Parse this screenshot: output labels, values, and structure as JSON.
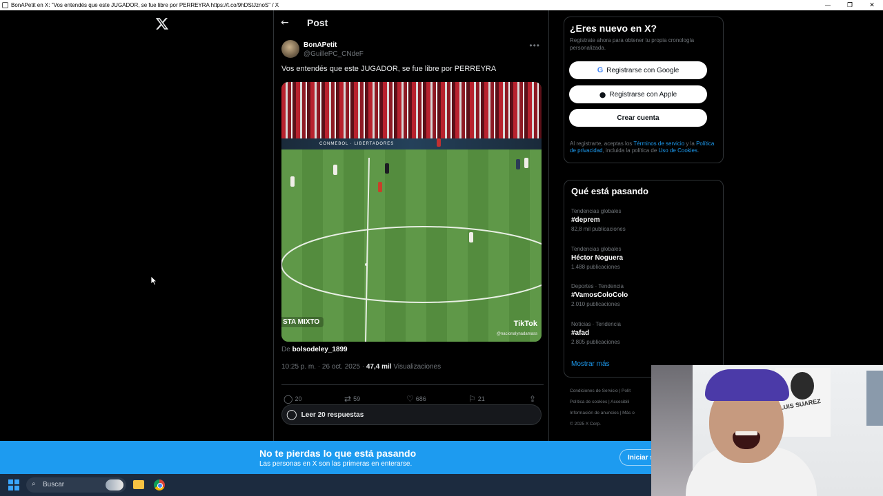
{
  "window": {
    "title": "BonAPetit en X: \"Vos entendés que este JUGADOR, se fue libre por PERREYRA https://t.co/9hDStJznoS\" / X",
    "controls": [
      "—",
      "❐",
      "✕"
    ]
  },
  "post": {
    "header_title": "Post",
    "author_name": "BonAPetit",
    "author_handle": "@GuillePC_CNdeF",
    "text": "Vos entendés que este JUGADOR, se fue libre por PERREYRA",
    "video": {
      "overlay_left": "STA MIXTO",
      "overlay_brand": "TikTok",
      "overlay_handle": "@nacionalynadamass",
      "adboard": "CONMEBOL · LIBERTADORES"
    },
    "from_prefix": "De",
    "from_user": "bolsodeley_1899",
    "time_date": "10:25 p. m. · 26 oct. 2025 · ",
    "views_count": "47,4 mil",
    "views_label": " Visualizaciones",
    "stats": {
      "replies": "20",
      "reposts": "59",
      "likes": "686",
      "bookmarks": "21"
    },
    "read_replies": "Leer 20 respuestas"
  },
  "signup": {
    "title": "¿Eres nuevo en X?",
    "subtitle": "Regístrate ahora para obtener tu propia cronología personalizada.",
    "google_label": "Registrarse con Google",
    "apple_label": "Registrarse con Apple",
    "create_label": "Crear cuenta",
    "legal_prefix": "Al registrarte, aceptas los ",
    "legal_terms": "Términos de servicio",
    "legal_mid1": " y la ",
    "legal_privacy": "Política de privacidad",
    "legal_mid2": ", incluida la política de ",
    "legal_cookies": "Uso de Cookies",
    "legal_end": "."
  },
  "trends": {
    "title": "Qué está pasando",
    "items": [
      {
        "context": "Tendencias globales",
        "name": "#deprem",
        "count": "82,8 mil publicaciones"
      },
      {
        "context": "Tendencias globales",
        "name": "Héctor Noguera",
        "count": "1.488 publicaciones"
      },
      {
        "context": "Deportes · Tendencia",
        "name": "#VamosColoColo",
        "count": "2.010 publicaciones"
      },
      {
        "context": "Noticias · Tendencia",
        "name": "#afad",
        "count": "2.805 publicaciones"
      }
    ],
    "show_more": "Mostrar más"
  },
  "footer": {
    "line1": "Condiciones de Servicio  |  Polít",
    "line2": "Política de cookies  |  Accesibili",
    "line3": "Información de anuncios  |  Más o",
    "line4": "© 2025 X Corp."
  },
  "banner": {
    "title": "No te pierdas lo que está pasando",
    "subtitle": "Las personas en X son las primeras en enterarse.",
    "button": "Iniciar s"
  },
  "taskbar": {
    "search_label": "Buscar"
  },
  "webcam": {
    "poster_text": "LUIS SUAREZ"
  },
  "colors": {
    "accent": "#1d9bf0",
    "background": "#000000",
    "border": "#2f3336",
    "muted_text": "#71767b"
  }
}
